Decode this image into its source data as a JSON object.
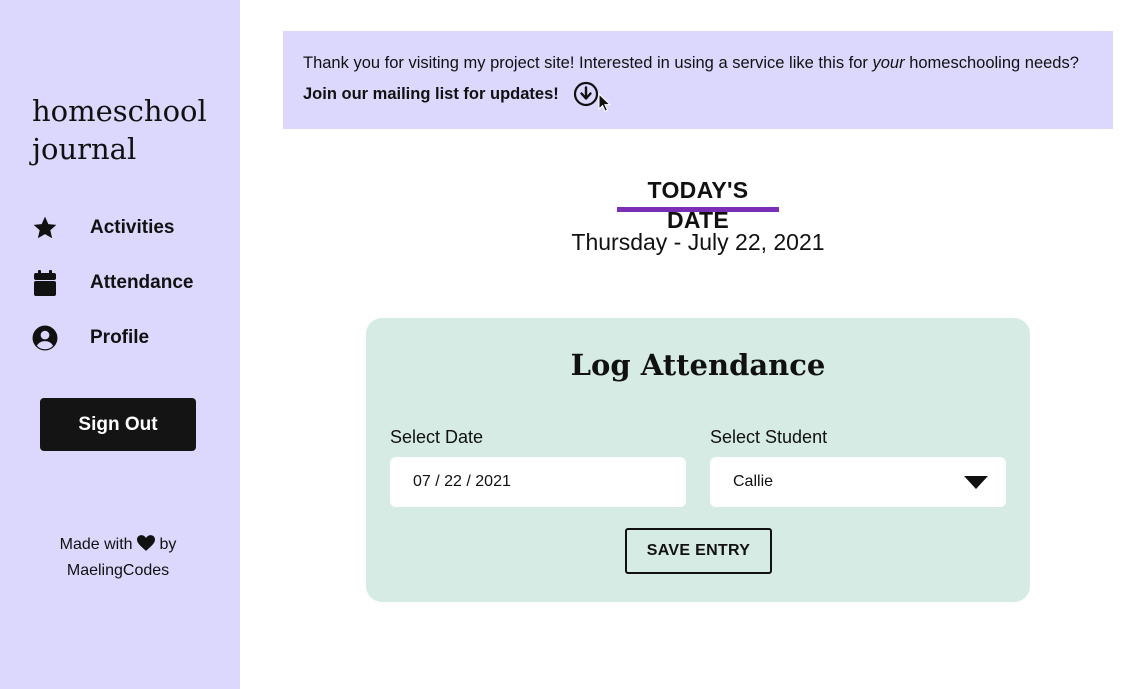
{
  "sidebar": {
    "logo_line1": "homeschool",
    "logo_line2": "journal",
    "nav": [
      {
        "label": "Activities",
        "icon": "star-icon"
      },
      {
        "label": "Attendance",
        "icon": "calendar-icon"
      },
      {
        "label": "Profile",
        "icon": "user-circle-icon"
      }
    ],
    "sign_out_label": "Sign Out",
    "credit_before": "Made with",
    "credit_after": "by",
    "credit_author": "MaelingCodes"
  },
  "banner": {
    "text_before": "Thank you for visiting my project site! Interested in using a service like this for ",
    "text_emphasis": "your",
    "text_after": " homeschooling needs?",
    "join_text": "Join our mailing list for updates!",
    "icon": "arrow-down-circle-icon"
  },
  "today": {
    "heading": "TODAY'S DATE",
    "value": "Thursday - July 22, 2021"
  },
  "attendance": {
    "title": "Log Attendance",
    "date_label": "Select Date",
    "date_value": "07 / 22 / 2021",
    "student_label": "Select Student",
    "student_value": "Callie",
    "save_label": "SAVE ENTRY"
  },
  "colors": {
    "sidebar_bg": "#dcd8fd",
    "banner_bg": "#dcd8fd",
    "card_bg": "#d6ebe3",
    "accent": "#7b2fb5",
    "button_dark": "#141414"
  }
}
